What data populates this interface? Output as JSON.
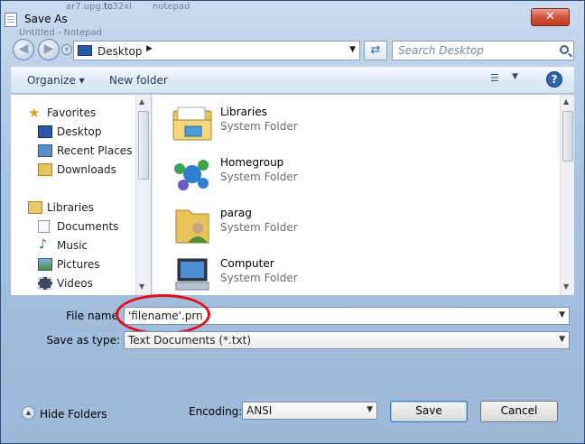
{
  "window": {
    "title": "Save As",
    "background_titles": [
      "ar7.upg.to",
      "tc32xl",
      "notepad",
      "Untitled - Notepad"
    ]
  },
  "colors": {
    "accent": "#2e63b3",
    "close": "#c23a1f",
    "highlight_ellipse": "#e0101b"
  },
  "nav_bar": {
    "back_icon": "back-arrow-icon",
    "forward_icon": "forward-arrow-icon",
    "location": "Desktop",
    "search_placeholder": "Search Desktop"
  },
  "command_bar": {
    "organize": "Organize",
    "new_folder": "New folder"
  },
  "navigation": {
    "favorites": {
      "header": "Favorites",
      "items": [
        {
          "label": "Desktop",
          "icon": "desktop-icon"
        },
        {
          "label": "Recent Places",
          "icon": "recent-places-icon"
        },
        {
          "label": "Downloads",
          "icon": "downloads-icon"
        }
      ]
    },
    "libraries": {
      "header": "Libraries",
      "items": [
        {
          "label": "Documents",
          "icon": "documents-icon"
        },
        {
          "label": "Music",
          "icon": "music-icon"
        },
        {
          "label": "Pictures",
          "icon": "pictures-icon"
        },
        {
          "label": "Videos",
          "icon": "videos-icon"
        }
      ]
    }
  },
  "files": [
    {
      "name": "Libraries",
      "type": "System Folder",
      "icon": "libraries-icon"
    },
    {
      "name": "Homegroup",
      "type": "System Folder",
      "icon": "homegroup-icon"
    },
    {
      "name": "parag",
      "type": "System Folder",
      "icon": "user-folder-icon"
    },
    {
      "name": "Computer",
      "type": "System Folder",
      "icon": "computer-icon"
    }
  ],
  "form": {
    "file_name_label": "File name",
    "file_name_value": "'filename'.prn",
    "save_type_label": "Save as type:",
    "save_type_value": "Text Documents (*.txt)",
    "encoding_label": "Encoding:",
    "encoding_value": "ANSI"
  },
  "buttons": {
    "hide_folders": "Hide Folders",
    "save": "Save",
    "cancel": "Cancel"
  }
}
